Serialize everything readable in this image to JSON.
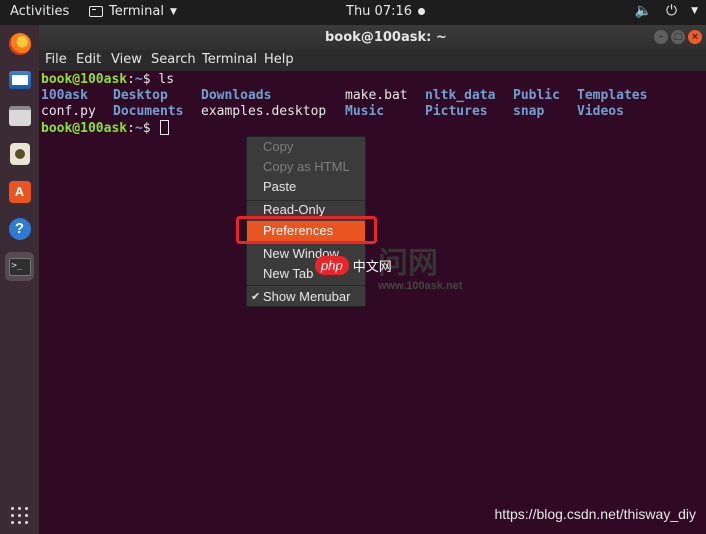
{
  "topbar": {
    "activities": "Activities",
    "app_name": "Terminal",
    "clock": "Thu 07:16",
    "volume_icon": "volume-icon",
    "power_icon": "power-icon"
  },
  "dock": {
    "items": [
      "firefox-icon",
      "thunderbird-mail-icon",
      "files-icon",
      "rhythmbox-icon",
      "software-store-icon",
      "help-icon",
      "terminal-icon"
    ],
    "apps_grid_icon": "show-applications-icon",
    "store_glyph": "A",
    "help_glyph": "?",
    "terminal_glyph": ">_"
  },
  "window": {
    "title": "book@100ask: ~",
    "menu": [
      "File",
      "Edit",
      "View",
      "Search",
      "Terminal",
      "Help"
    ]
  },
  "terminal": {
    "prompt_user": "book@100ask",
    "prompt_sep": ":",
    "prompt_path": "~",
    "prompt_symbol": "$ ",
    "command": "ls",
    "row1": [
      "100ask",
      "Desktop",
      "Downloads",
      "make.bat",
      "nltk_data",
      "Public",
      "Templates"
    ],
    "row2": [
      "conf.py",
      "Documents",
      "examples.desktop",
      "Music",
      "Pictures",
      "snap",
      "Videos"
    ]
  },
  "context_menu": {
    "items": [
      "Copy",
      "Copy as HTML",
      "Paste",
      "Read-Only",
      "Preferences",
      "New Window",
      "New Tab",
      "Show Menubar"
    ],
    "check_mark": "✔",
    "highlighted": "Preferences"
  },
  "colors": {
    "terminal_bg": "#300a24",
    "accent": "#e95420",
    "prompt_green": "#8ae234",
    "dir_blue": "#729fcf"
  },
  "watermarks": {
    "php_badge": "php",
    "php_text": "中文网",
    "ghost_text": "问网",
    "site_url": "www.100ask.net",
    "csdn": "https://blog.csdn.net/thisway_diy"
  }
}
